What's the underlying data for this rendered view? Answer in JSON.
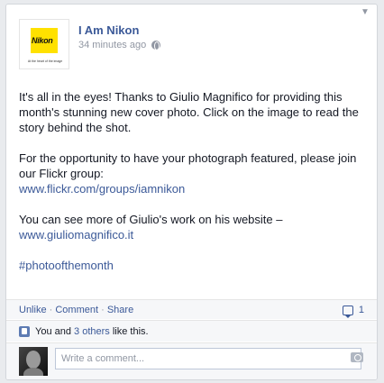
{
  "post": {
    "page_name": "I Am Nikon",
    "timestamp": "34 minutes ago",
    "logo_text": "Nikon",
    "logo_tagline": "At the heart of the image",
    "paragraph1": "It's all in the eyes! Thanks to Giulio Magnifico for providing this month's stunning new cover photo. Click on the image to read the story behind the shot.",
    "paragraph2_text": "For the opportunity to have your photograph featured, please join our Flickr group:",
    "paragraph2_link": "www.flickr.com/groups/iamnikon",
    "paragraph3_text": "You can see more of Giulio's work on his website –",
    "paragraph3_link": "www.giuliomagnifico.it",
    "hashtag": "#photoofthemonth"
  },
  "actions": {
    "unlike": "Unlike",
    "comment": "Comment",
    "share": "Share",
    "separator": " · ",
    "comment_count": "1"
  },
  "likes": {
    "prefix": "You and ",
    "others_link": "3 others",
    "suffix": " like this."
  },
  "comment_box": {
    "placeholder": "Write a comment..."
  },
  "icons": [
    "chevron-down-icon",
    "globe-icon",
    "comment-icon",
    "thumbs-up-icon",
    "camera-icon"
  ]
}
